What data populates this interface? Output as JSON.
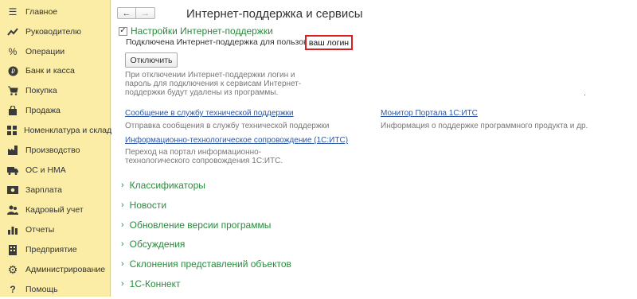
{
  "sidebar": {
    "items": [
      {
        "label": "Главное",
        "icon": "menu-lines-icon"
      },
      {
        "label": "Руководителю",
        "icon": "trend-line-icon"
      },
      {
        "label": "Операции",
        "icon": "percent-coins-icon"
      },
      {
        "label": "Банк и касса",
        "icon": "ruble-coin-icon"
      },
      {
        "label": "Покупка",
        "icon": "cart-icon"
      },
      {
        "label": "Продажа",
        "icon": "bag-icon"
      },
      {
        "label": "Номенклатура и склад",
        "icon": "grid-icon"
      },
      {
        "label": "Производство",
        "icon": "factory-icon"
      },
      {
        "label": "ОС и НМА",
        "icon": "truck-icon"
      },
      {
        "label": "Зарплата",
        "icon": "money-icon"
      },
      {
        "label": "Кадровый учет",
        "icon": "people-icon"
      },
      {
        "label": "Отчеты",
        "icon": "bar-chart-icon"
      },
      {
        "label": "Предприятие",
        "icon": "building-icon"
      },
      {
        "label": "Администрирование",
        "icon": "gear-icon"
      },
      {
        "label": "Помощь",
        "icon": "question-icon"
      }
    ]
  },
  "header": {
    "title": "Интернет-поддержка и сервисы",
    "back": "←",
    "forward": "→"
  },
  "support": {
    "section_title": "Настройки Интернет-поддержки",
    "connected_text": "Подключена Интернет-поддержка для пользователя",
    "login": "ваш логин",
    "disconnect_button": "Отключить",
    "note": "При отключении Интернет-поддержки логин и пароль для подключения к сервисам Интернет-поддержки будут удалены из программы."
  },
  "links": {
    "tech_support": {
      "label": "Сообщение в службу технической поддержки",
      "desc": "Отправка сообщения в службу технической поддержки"
    },
    "its": {
      "label": "Информационно-технологическое сопровождение (1С:ИТС)",
      "desc": "Переход на портал информационно-технологического сопровождения 1С:ИТС."
    },
    "monitor": {
      "label": "Монитор Портала 1С:ИТС",
      "desc": "Информация о поддержке программного продукта и др."
    }
  },
  "groups": [
    "Классификаторы",
    "Новости",
    "Обновление версии программы",
    "Обсуждения",
    "Склонения представлений объектов",
    "1С-Коннект"
  ],
  "colors": {
    "sidebar_bg": "#fbeda5",
    "green_text": "#2a8b3d",
    "link": "#2d57a6",
    "login_border": "#d81f1f"
  }
}
